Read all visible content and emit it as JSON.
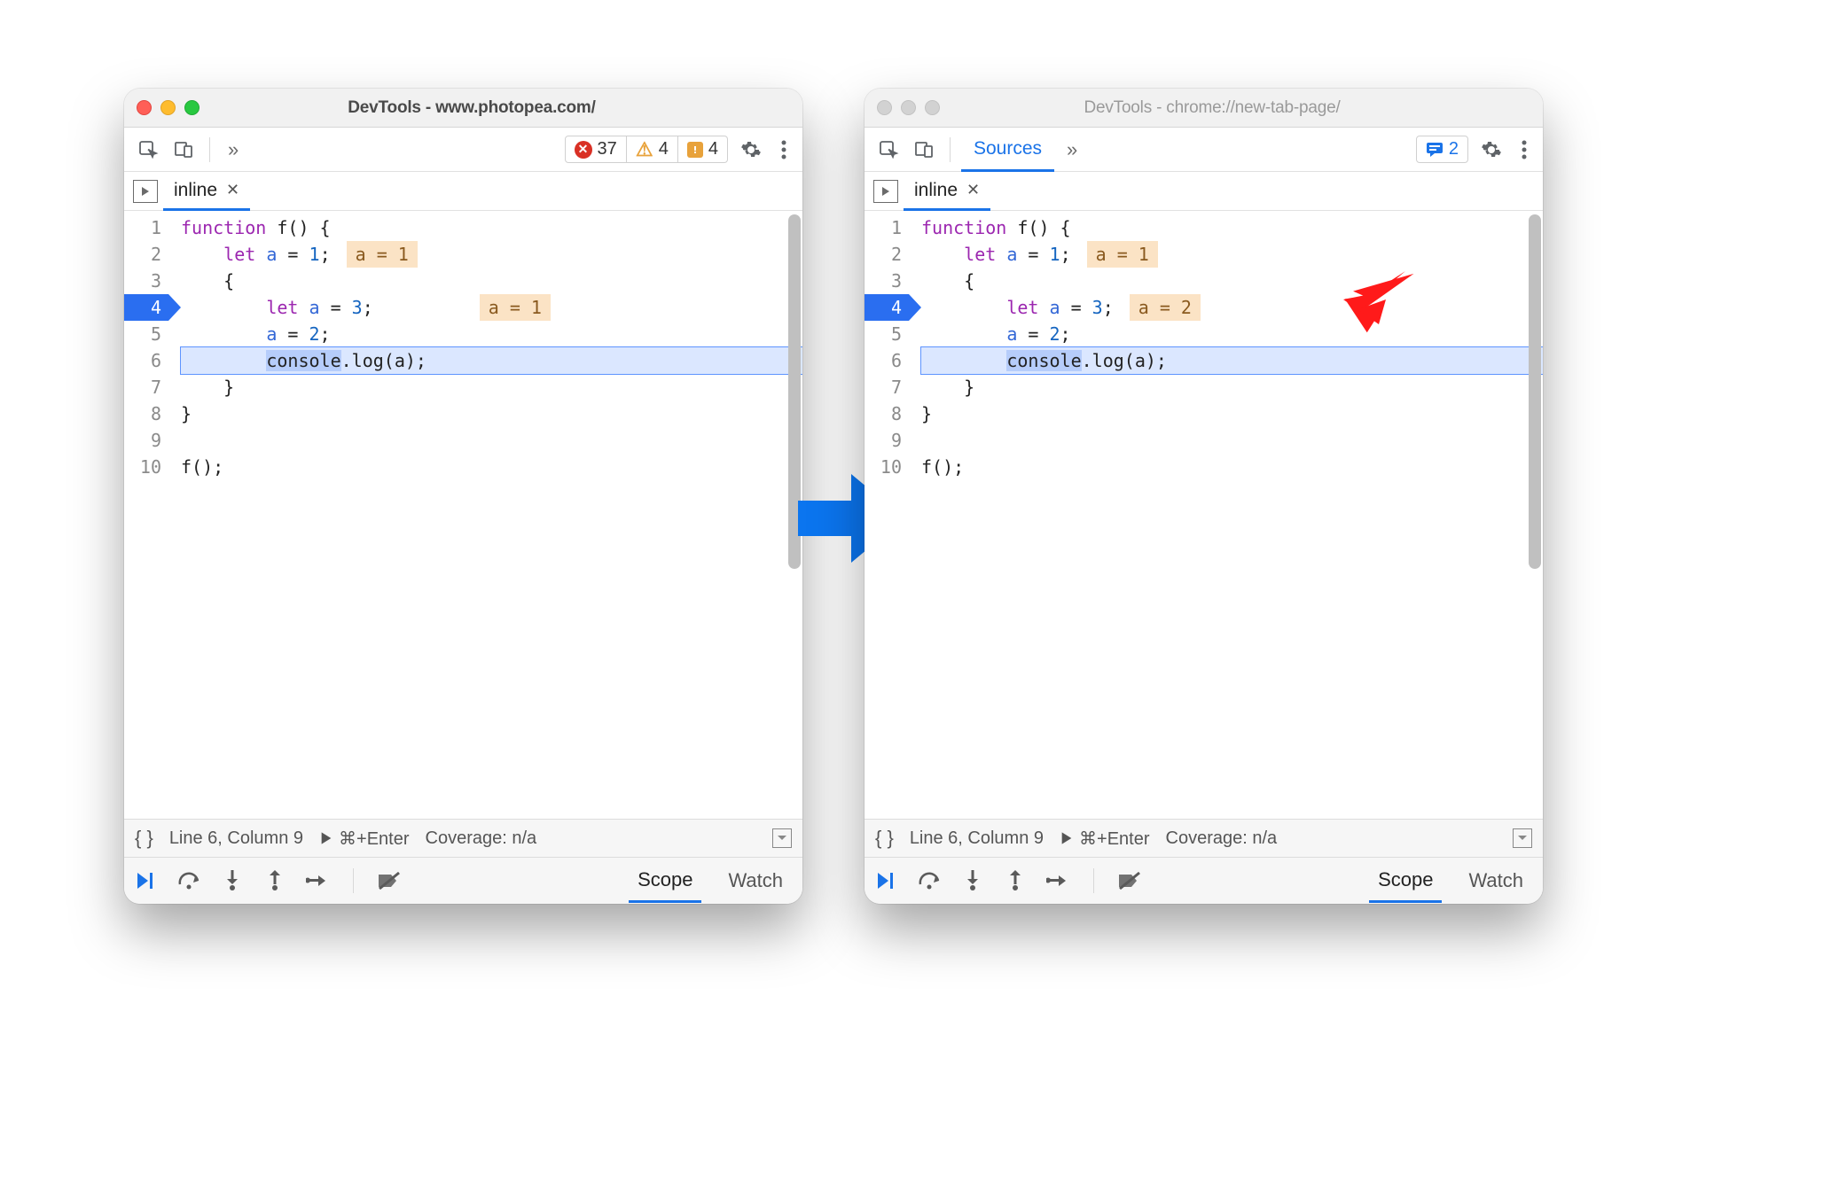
{
  "left": {
    "active": true,
    "title": "DevTools - www.photopea.com/",
    "toolbar": {
      "chevrons": "»",
      "errors": "37",
      "warnings": "4",
      "issues": "4"
    },
    "file_tab": "inline",
    "code": {
      "lines": [
        "1",
        "2",
        "3",
        "4",
        "5",
        "6",
        "7",
        "8",
        "9",
        "10"
      ],
      "exec_line": 4,
      "current_line": 6,
      "tokens": {
        "l1": {
          "kw": "function",
          "sp": " ",
          "fn": "f",
          "rest": "() {"
        },
        "l2": {
          "indent": "    ",
          "kw": "let",
          "sp": " ",
          "id": "a",
          "eq": " = ",
          "num": "1",
          "semi": ";",
          "inline": "a = 1"
        },
        "l3": {
          "indent": "    ",
          "brace": "{"
        },
        "l4": {
          "indent": "        ",
          "kw": "let",
          "sp": " ",
          "id": "a",
          "eq": " = ",
          "num": "3",
          "semi": ";",
          "inline": "a = 1"
        },
        "l5": {
          "indent": "        ",
          "id": "a",
          "eq": " = ",
          "num": "2",
          "semi": ";"
        },
        "l6": {
          "indent": "        ",
          "sel": "console",
          "rest": ".log(a);"
        },
        "l7": {
          "indent": "    ",
          "brace": "}"
        },
        "l8": {
          "brace": "}"
        },
        "l9": {
          "blank": ""
        },
        "l10": {
          "call": "f();"
        }
      }
    },
    "statusbar": {
      "linecol": "Line 6, Column 9",
      "run": "⌘+Enter",
      "coverage": "Coverage: n/a"
    },
    "dbgtabs": {
      "scope": "Scope",
      "watch": "Watch"
    }
  },
  "right": {
    "active": false,
    "title": "DevTools - chrome://new-tab-page/",
    "toolbar": {
      "tab_label": "Sources",
      "chevrons": "»",
      "messages": "2"
    },
    "file_tab": "inline",
    "code": {
      "lines": [
        "1",
        "2",
        "3",
        "4",
        "5",
        "6",
        "7",
        "8",
        "9",
        "10"
      ],
      "exec_line": 4,
      "current_line": 6,
      "tokens": {
        "l1": {
          "kw": "function",
          "sp": " ",
          "fn": "f",
          "rest": "() {"
        },
        "l2": {
          "indent": "    ",
          "kw": "let",
          "sp": " ",
          "id": "a",
          "eq": " = ",
          "num": "1",
          "semi": ";",
          "inline": "a = 1"
        },
        "l3": {
          "indent": "    ",
          "brace": "{"
        },
        "l4": {
          "indent": "        ",
          "kw": "let",
          "sp": " ",
          "id": "a",
          "eq": " = ",
          "num": "3",
          "semi": ";",
          "inline": "a = 2"
        },
        "l5": {
          "indent": "        ",
          "id": "a",
          "eq": " = ",
          "num": "2",
          "semi": ";"
        },
        "l6": {
          "indent": "        ",
          "sel": "console",
          "rest": ".log(a);"
        },
        "l7": {
          "indent": "    ",
          "brace": "}"
        },
        "l8": {
          "brace": "}"
        },
        "l9": {
          "blank": ""
        },
        "l10": {
          "call": "f();"
        }
      }
    },
    "statusbar": {
      "linecol": "Line 6, Column 9",
      "run": "⌘+Enter",
      "coverage": "Coverage: n/a"
    },
    "dbgtabs": {
      "scope": "Scope",
      "watch": "Watch"
    }
  }
}
